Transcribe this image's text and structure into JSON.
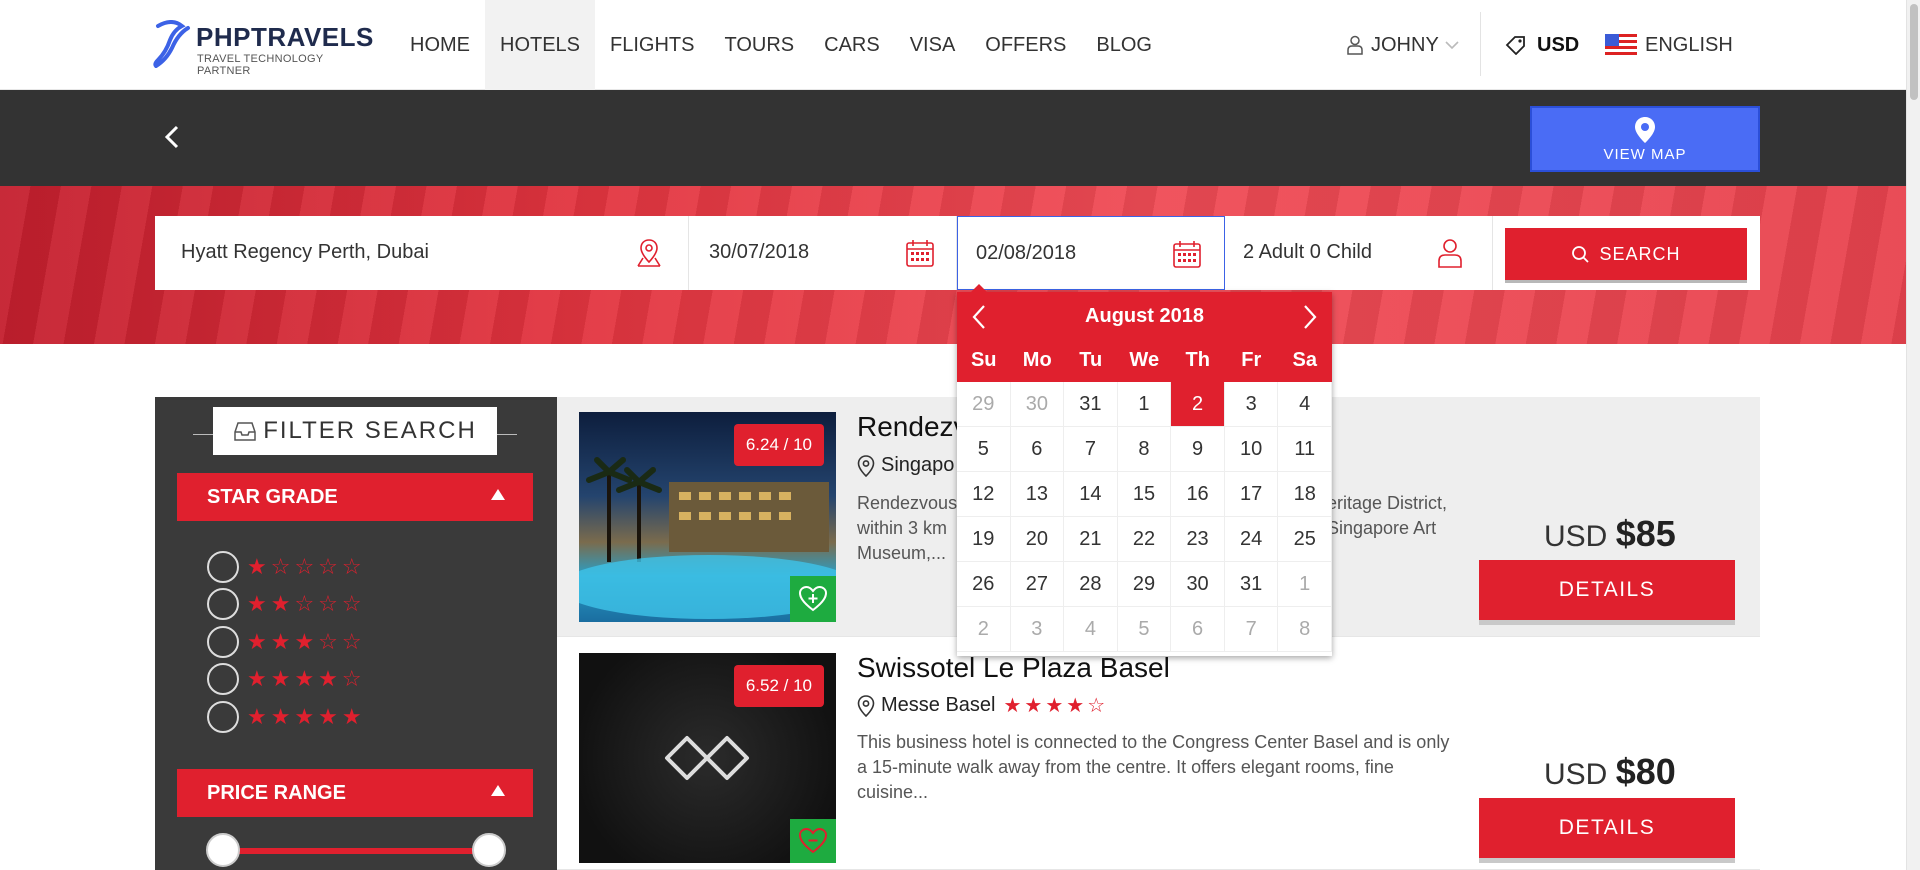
{
  "brand": {
    "name": "PHPTRAVELS",
    "tagline": "TRAVEL TECHNOLOGY PARTNER"
  },
  "nav": [
    "HOME",
    "HOTELS",
    "FLIGHTS",
    "TOURS",
    "CARS",
    "VISA",
    "OFFERS",
    "BLOG"
  ],
  "nav_active": "HOTELS",
  "user": {
    "name": "JOHNY"
  },
  "currency": "USD",
  "language": "ENGLISH",
  "view_map": "VIEW MAP",
  "search": {
    "location": "Hyatt Regency Perth, Dubai",
    "checkin": "30/07/2018",
    "checkout": "02/08/2018",
    "guests": "2 Adult 0 Child",
    "button": "SEARCH"
  },
  "datepicker": {
    "month": "August 2018",
    "days_of_week": [
      "Su",
      "Mo",
      "Tu",
      "We",
      "Th",
      "Fr",
      "Sa"
    ],
    "cells": [
      "29",
      "30",
      "31",
      "1",
      "2",
      "3",
      "4",
      "5",
      "6",
      "7",
      "8",
      "9",
      "10",
      "11",
      "12",
      "13",
      "14",
      "15",
      "16",
      "17",
      "18",
      "19",
      "20",
      "21",
      "22",
      "23",
      "24",
      "25",
      "26",
      "27",
      "28",
      "29",
      "30",
      "31",
      "1",
      "2",
      "3",
      "4",
      "5",
      "6",
      "7",
      "8"
    ],
    "muted_indices": [
      0,
      1,
      34,
      35,
      36,
      37,
      38,
      39,
      40,
      41
    ],
    "selected_index": 4
  },
  "filter": {
    "title": "FILTER SEARCH",
    "star_grade": "STAR GRADE",
    "price_range": "PRICE RANGE",
    "star_rows": [
      "★☆☆☆☆",
      "★★☆☆☆",
      "★★★☆☆",
      "★★★★☆",
      "★★★★★"
    ]
  },
  "hotels": [
    {
      "name": "Rendezvous Hotel Singapore",
      "name_visible": "Rendezv",
      "location": "Singapo",
      "stars": "",
      "score": "6.24 / 10",
      "description_line1": "Rendezvous",
      "description_line1_tail": "eritage District,",
      "description_line2": "within 3 km",
      "description_line2_tail": "Singapore Art",
      "description_line3": "Museum,...",
      "currency": "USD",
      "price": "$85",
      "button": "DETAILS"
    },
    {
      "name": "Swissotel Le Plaza Basel",
      "location": "Messe Basel",
      "stars": "★★★★☆",
      "score": "6.52 / 10",
      "description": "This business hotel is connected to the Congress Center Basel and is only a 15-minute walk away from the centre. It offers elegant rooms, fine cuisine...",
      "currency": "USD",
      "price": "$80",
      "button": "DETAILS"
    }
  ],
  "colors": {
    "accent": "#e0202e",
    "dark": "#333333",
    "map_button": "#4a6cf5",
    "favorite": "#1eab40"
  }
}
